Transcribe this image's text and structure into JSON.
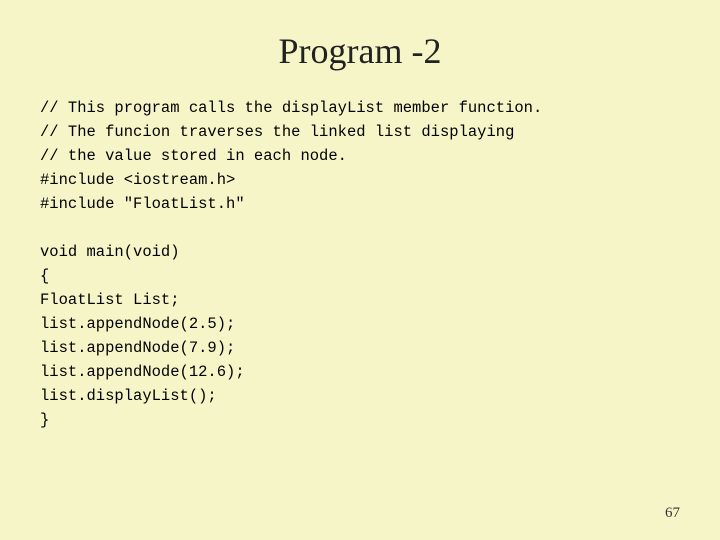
{
  "slide": {
    "title": "Program -2",
    "code": "// This program calls the displayList member function.\n// The funcion traverses the linked list displaying\n// the value stored in each node.\n#include <iostream.h>\n#include \"FloatList.h\"\n\nvoid main(void)\n{\nFloatList List;\nlist.appendNode(2.5);\nlist.appendNode(7.9);\nlist.appendNode(12.6);\nlist.displayList();\n}",
    "page_number": "67"
  }
}
